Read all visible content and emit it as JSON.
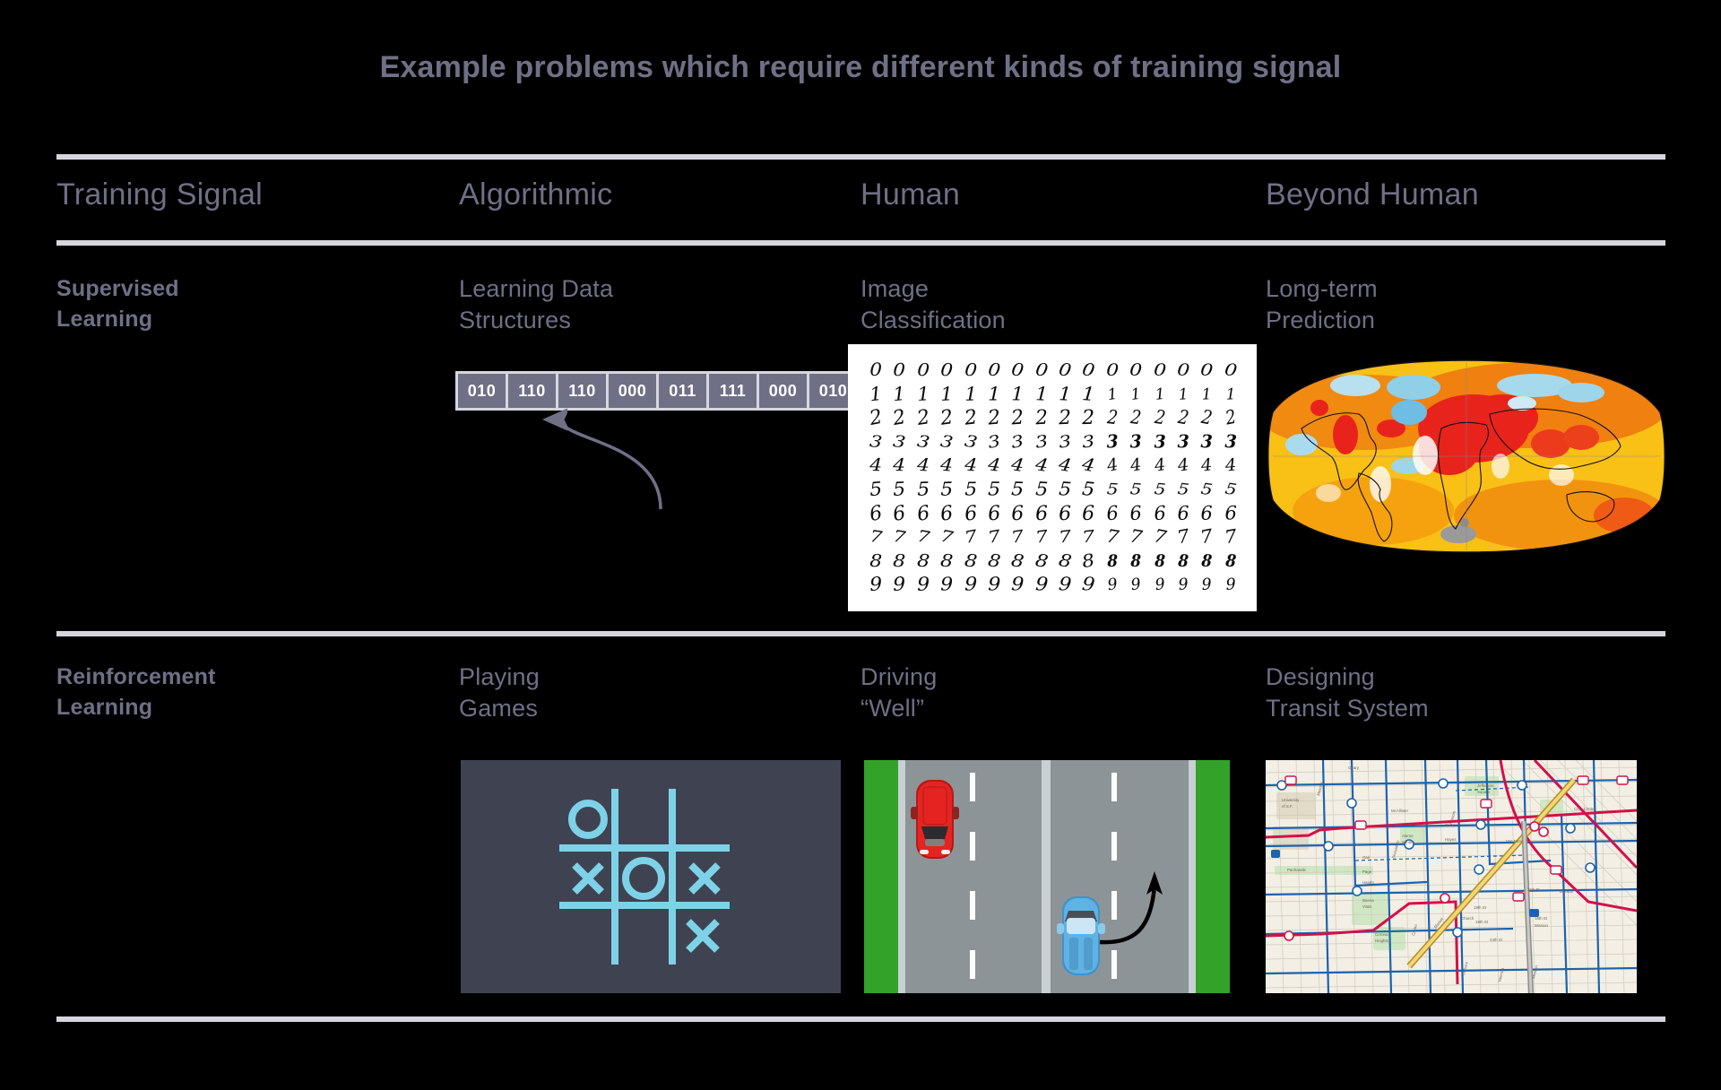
{
  "title": "Example problems which require different kinds of training signal",
  "colors": {
    "background": "#000000",
    "text": "#6f7086",
    "rule": "#d6d6de",
    "array_cell": "#6f7086",
    "array_text": "#ffffff",
    "tictactoe_bg": "#3f4351",
    "tictactoe_mark": "#7ed2e8",
    "road_grass": "#33a229",
    "road_surface": "#8d9498",
    "car_red": "#e52421",
    "car_blue": "#5eb3e4",
    "transit_blue": "#1b63ad",
    "transit_red": "#d2104a"
  },
  "table": {
    "headers": [
      "Training Signal",
      "Algorithmic",
      "Human",
      "Beyond Human"
    ],
    "rows": [
      {
        "label": "Supervised\nLearning",
        "cells": [
          {
            "title": "Learning Data\nStructures",
            "figure": "binary-array"
          },
          {
            "title": "Image\nClassification",
            "figure": "mnist-digit-grid"
          },
          {
            "title": "Long-term\nPrediction",
            "figure": "global-temperature-anomaly-map"
          }
        ]
      },
      {
        "label": "Reinforcement\nLearning",
        "cells": [
          {
            "title": "Playing\nGames",
            "figure": "tic-tac-toe-board"
          },
          {
            "title": "Driving\n“Well”",
            "figure": "road-overhead-view"
          },
          {
            "title": "Designing\nTransit System",
            "figure": "city-transit-map"
          }
        ]
      }
    ]
  },
  "binary_array": {
    "cells": [
      "010",
      "110",
      "110",
      "000",
      "011",
      "111",
      "000",
      "010"
    ],
    "arrow_from_index": 6,
    "arrow_to_index": 2
  },
  "mnist": {
    "rows": 10,
    "columns": 16,
    "digits": [
      "0",
      "1",
      "2",
      "3",
      "4",
      "5",
      "6",
      "7",
      "8",
      "9"
    ]
  },
  "tictactoe": {
    "board": [
      [
        "O",
        "",
        ""
      ],
      [
        "X",
        "O",
        "X"
      ],
      [
        "",
        "",
        "X"
      ]
    ]
  },
  "road": {
    "lanes": 2,
    "cars": [
      {
        "color": "red",
        "lane": "left",
        "position": "top"
      },
      {
        "color": "blue",
        "lane": "right",
        "position": "bottom"
      }
    ],
    "arrow": "lane-change-curve-up"
  },
  "transit": {
    "street_labels": [
      "Geary",
      "Masonic",
      "McAllister",
      "Fulton",
      "Grove",
      "Hayes",
      "Oak",
      "Page",
      "Haight",
      "Divisadero",
      "Castro",
      "Church",
      "Market",
      "Mission",
      "Valencia",
      "Duboce",
      "16th St",
      "18th St",
      "19th St",
      "24th St",
      "Van Ness",
      "Folsom",
      "Bryant",
      "Harrison",
      "Howard",
      "Cesar Chavez",
      "Potrero",
      "Alamo Square",
      "Jefferson Square",
      "Buena Vista",
      "Corona Heights",
      "Panhandle",
      "University of San Francisco",
      "Civic Center",
      "16th St Mission"
    ]
  }
}
